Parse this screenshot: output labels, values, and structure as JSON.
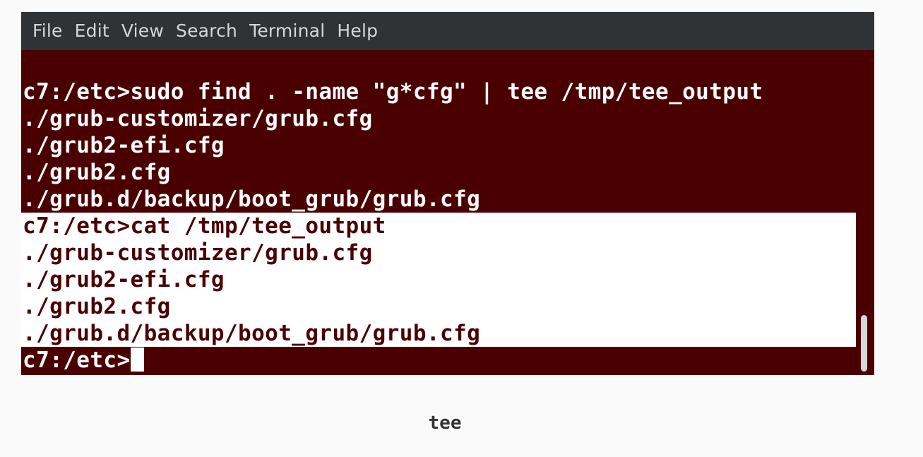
{
  "menu": [
    "File",
    "Edit",
    "View",
    "Search",
    "Terminal",
    "Help"
  ],
  "terminal": {
    "lines": [
      "c7:/etc>sudo find . -name \"g*cfg\" | tee /tmp/tee_output",
      "./grub-customizer/grub.cfg",
      "./grub2-efi.cfg",
      "./grub2.cfg",
      "./grub.d/backup/boot_grub/grub.cfg",
      "c7:/etc>cat /tmp/tee_output",
      "./grub-customizer/grub.cfg",
      "./grub2-efi.cfg",
      "./grub2.cfg",
      "./grub.d/backup/boot_grub/grub.cfg"
    ],
    "prompt": "c7:/etc>"
  },
  "caption": "tee",
  "colors": {
    "terminal_bg": "#4a0001",
    "terminal_fg": "#ffffff",
    "selection_bg": "#ffffff",
    "menubar_bg": "#2f3336",
    "menubar_fg": "#d6d6d6"
  }
}
